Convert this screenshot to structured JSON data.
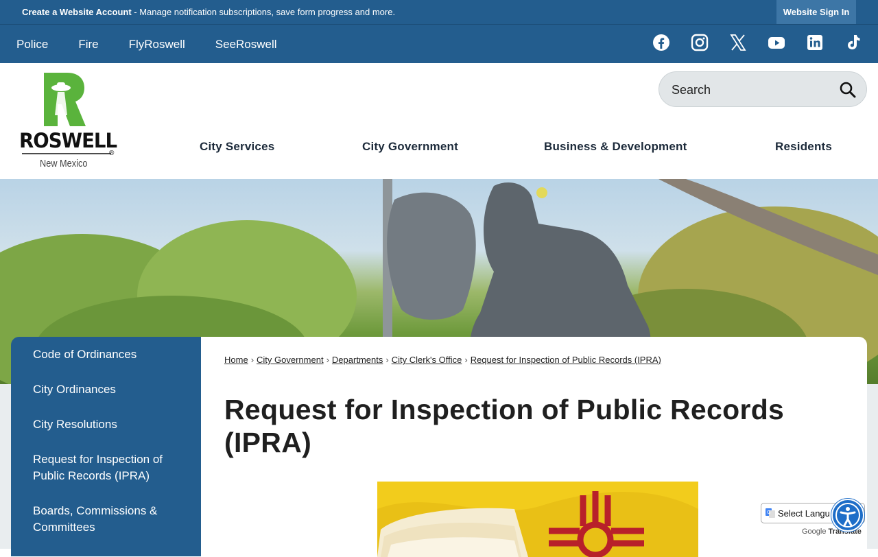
{
  "topbar": {
    "account_bold": "Create a Website Account",
    "account_rest": " - Manage notification subscriptions, save form progress and more.",
    "signin": "Website Sign In"
  },
  "subnav": {
    "links": [
      "Police",
      "Fire",
      "FlyRoswell",
      "SeeRoswell"
    ],
    "socials": [
      "facebook-icon",
      "instagram-icon",
      "x-icon",
      "youtube-icon",
      "linkedin-icon",
      "tiktok-icon"
    ]
  },
  "logo": {
    "title": "ROSWELL",
    "subtitle": "New Mexico",
    "mark": "®"
  },
  "search": {
    "placeholder": "Search"
  },
  "mainnav": [
    "City Services",
    "City Government",
    "Business & Development",
    "Residents"
  ],
  "sidebar": [
    "Code of Ordinances",
    "City Ordinances",
    "City Resolutions",
    "Request for Inspection of Public Records (IPRA)",
    "Boards, Commissions & Committees"
  ],
  "breadcrumb": [
    "Home",
    "City Government",
    "Departments",
    "City Clerk's Office",
    "Request for Inspection of Public Records (IPRA)"
  ],
  "page_title": "Request for Inspection of Public Records (IPRA)",
  "translate": {
    "select_label": "Select Langu",
    "powered": "Google",
    "translate_word": "Translate"
  },
  "colors": {
    "brand_blue": "#235d8e",
    "logo_green": "#5ab33c",
    "nm_yellow": "#f2cc1c",
    "nm_red": "#b8202a"
  }
}
